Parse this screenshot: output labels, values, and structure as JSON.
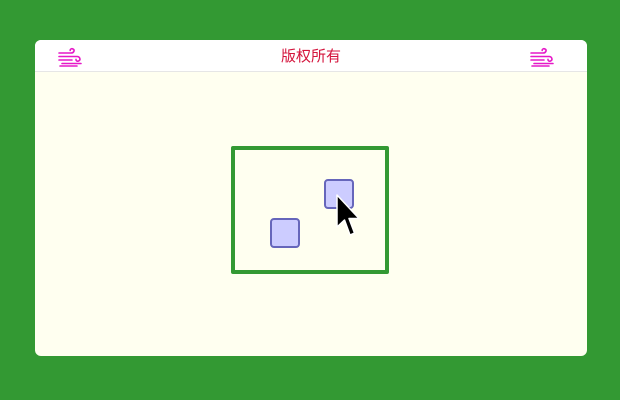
{
  "window": {
    "title": "版权所有"
  },
  "icons": {
    "left_button": "wind-icon",
    "right_button": "wind-icon",
    "cursor": "mouse-pointer-icon"
  },
  "colors": {
    "background": "#339933",
    "panel": "#fffff0",
    "title": "#d4143c",
    "icon": "#e619c8",
    "square_fill": "#ccccff",
    "square_border": "#6666bb",
    "playfield_border": "#339933"
  }
}
